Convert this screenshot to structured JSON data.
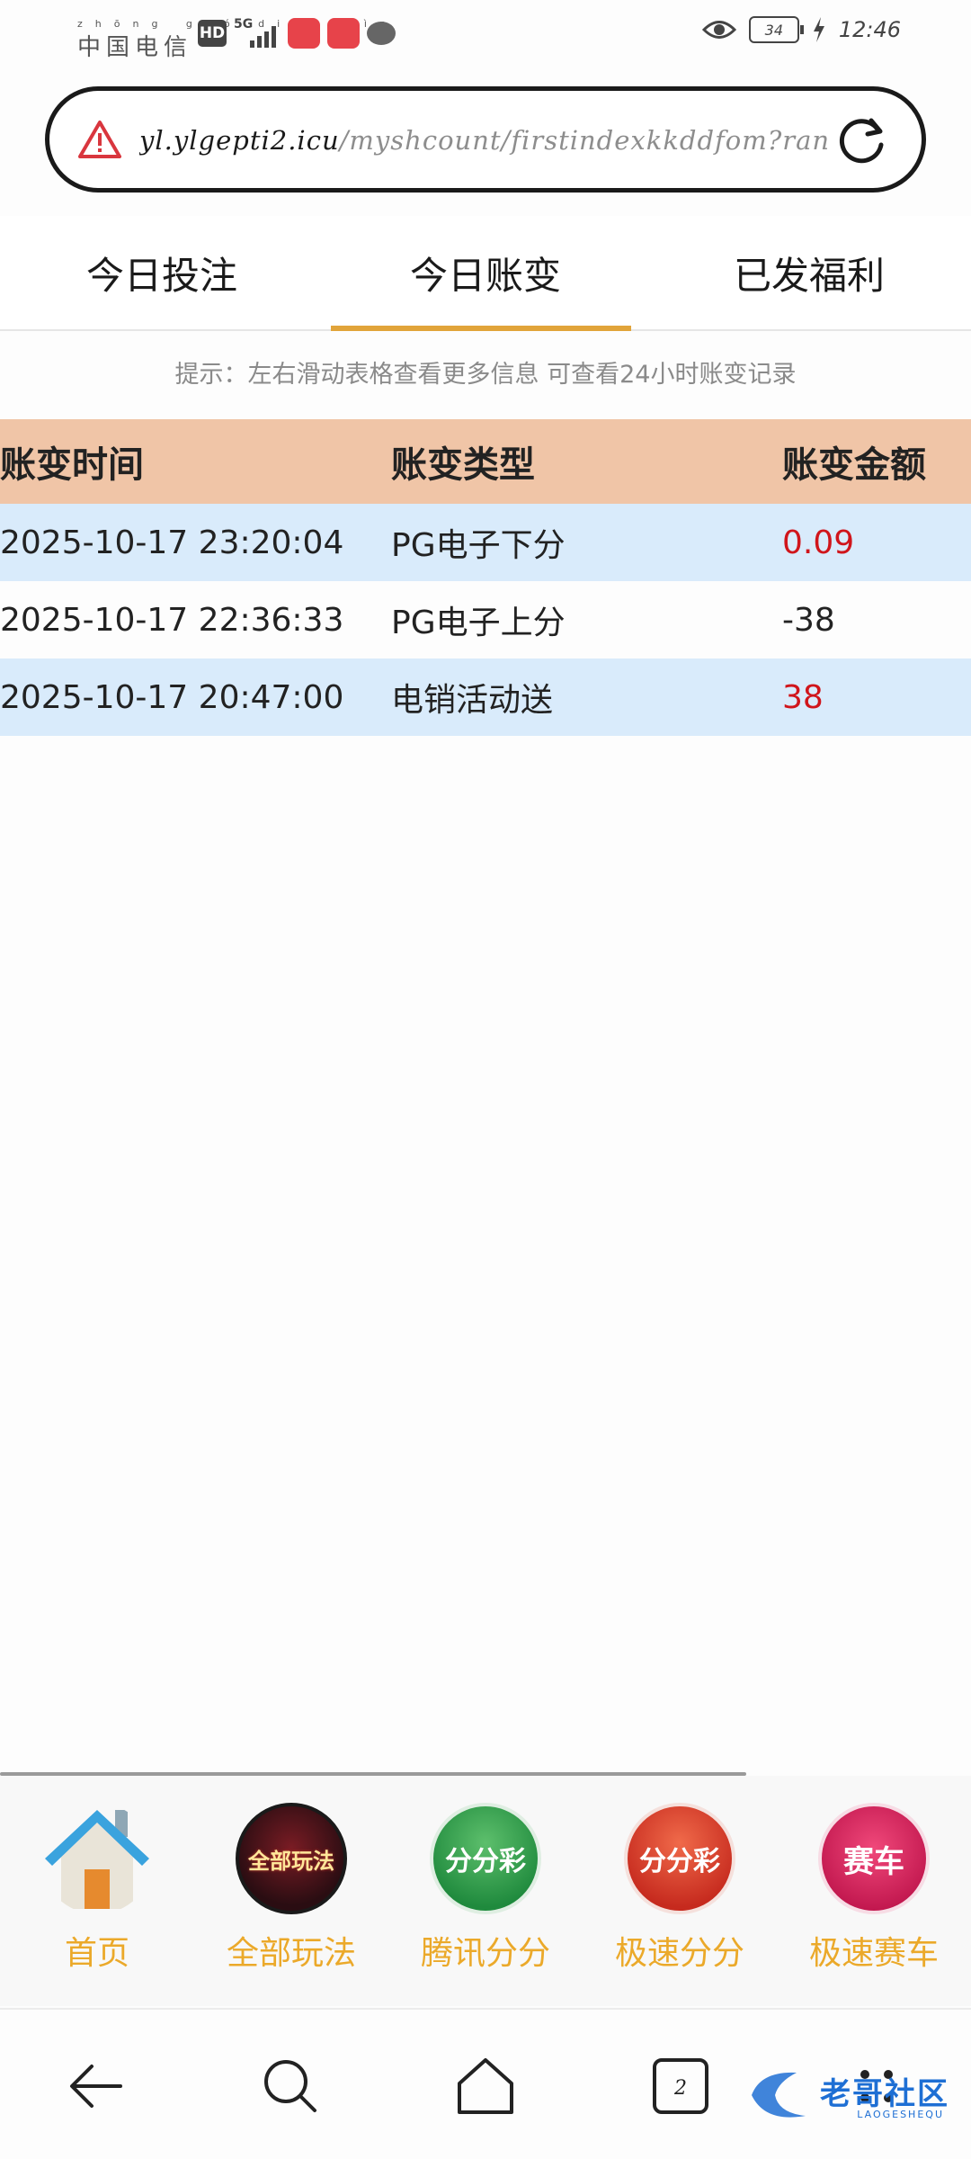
{
  "status_bar": {
    "carrier_pinyin": "zhōng guó diàn xìn",
    "carrier": "中国电信",
    "hd": "HD",
    "network": "5G",
    "battery": "34",
    "time": "12:46"
  },
  "browser": {
    "url_host": "yl.ylgepti2.icu",
    "url_path": "/myshcount/firstindexkkddfom?ran"
  },
  "tabs": [
    {
      "label": "今日投注",
      "active": false
    },
    {
      "label": "今日账变",
      "active": true
    },
    {
      "label": "已发福利",
      "active": false
    }
  ],
  "hint": "提示：左右滑动表格查看更多信息  可查看24小时账变记录",
  "table": {
    "headers": [
      "账变时间",
      "账变类型",
      "账变金额"
    ],
    "rows": [
      {
        "time": "2025-10-17 23:20:04",
        "type": "PG电子下分",
        "amount": "0.09"
      },
      {
        "time": "2025-10-17 22:36:33",
        "type": "PG电子上分",
        "amount": "-38"
      },
      {
        "time": "2025-10-17 20:47:00",
        "type": "电销活动送",
        "amount": "38"
      }
    ]
  },
  "bottom_nav": [
    {
      "label": "首页",
      "icon": "home-icon",
      "icon_text": ""
    },
    {
      "label": "全部玩法",
      "icon": "all-games-icon",
      "icon_text": "全部玩法"
    },
    {
      "label": "腾讯分分",
      "icon": "tencent-ffc-icon",
      "icon_text": "分分彩"
    },
    {
      "label": "极速分分",
      "icon": "speed-ffc-icon",
      "icon_text": "分分彩"
    },
    {
      "label": "极速赛车",
      "icon": "speed-racing-icon",
      "icon_text": "赛车"
    }
  ],
  "watermark": {
    "text": "老哥社区",
    "sub": "LAOGESHEQU"
  },
  "colors": {
    "tab_underline": "#e1a43a",
    "table_header": "#f0c5a7",
    "row_shade": "#d9ebfb",
    "amount_red": "#d0151b",
    "nav_label": "#eba92a"
  }
}
